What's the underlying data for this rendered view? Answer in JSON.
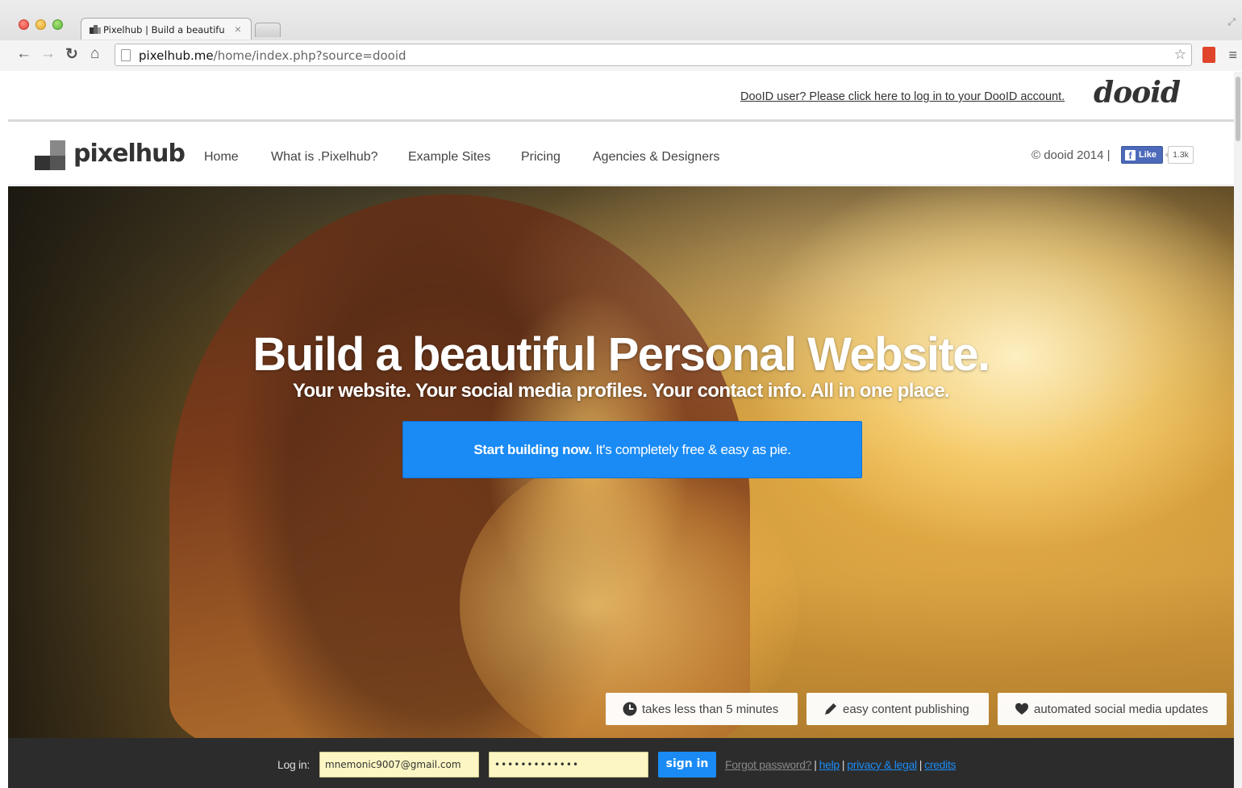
{
  "browser": {
    "tab_title": "Pixelhub | Build a beautifu",
    "tab_close": "×",
    "url_host": "pixelhub.me",
    "url_path": "/home/index.php?source=dooid"
  },
  "dooid_bar": {
    "login_link": "DooID user? Please click here to log in to your DooID account.",
    "logo": "dooid"
  },
  "nav": {
    "logo_text": "pixelhub",
    "items": [
      "Home",
      "What is .Pixelhub?",
      "Example Sites",
      "Pricing",
      "Agencies & Designers"
    ],
    "copyright": "© dooid 2014 |",
    "fb_like": "Like",
    "fb_count": "1.3k"
  },
  "hero": {
    "title": "Build a beautiful Personal Website.",
    "subtitle": "Your website. Your social media profiles. Your contact info. All in one place.",
    "cta_bold": "Start building now.",
    "cta_rest": " It's completely free & easy as pie.",
    "features": [
      {
        "icon": "clock-icon",
        "label": "takes less than 5 minutes"
      },
      {
        "icon": "pencil-icon",
        "label": "easy content publishing"
      },
      {
        "icon": "heart-icon",
        "label": "automated social media updates"
      }
    ]
  },
  "login": {
    "label": "Log in:",
    "email_value": "mnemonic9007@gmail.com",
    "password_value": "•••••••••••••",
    "signin_label": "sign in",
    "forgot": "Forgot password?",
    "links": [
      "help",
      "privacy & legal",
      "credits"
    ],
    "separator": "|"
  },
  "colors": {
    "accent_blue": "#1a8bf5",
    "login_bar": "#2c2c2c",
    "input_bg": "#fbf6c3"
  }
}
